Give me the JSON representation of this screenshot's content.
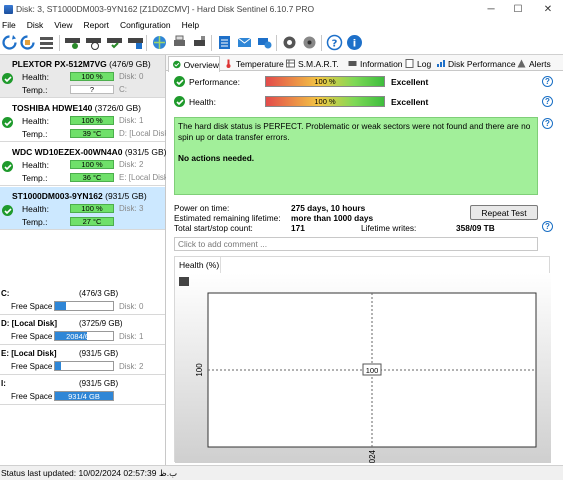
{
  "window": {
    "title": "Disk: 3, ST1000DM003-9YN162 [Z1D0ZCMV]  -  Hard Disk Sentinel 6.10.7 PRO",
    "minimize": "─",
    "maximize": "☐",
    "close": "✕"
  },
  "menu": [
    "File",
    "Disk",
    "View",
    "Report",
    "Configuration",
    "Help"
  ],
  "disks": [
    {
      "name": "PLEXTOR PX-512M7VG",
      "size": "(476/9 GB)",
      "health_label": "Health:",
      "health": "100 %",
      "health_pct": 100,
      "disk_idx": "Disk: 0",
      "temp_label": "Temp.:",
      "temp": "?",
      "temp_extra": "C:"
    },
    {
      "name": "TOSHIBA HDWE140",
      "size": "(3726/0 GB)",
      "health_label": "Health:",
      "health": "100 %",
      "health_pct": 100,
      "disk_idx": "Disk: 1",
      "temp_label": "Temp.:",
      "temp": "39 °C",
      "temp_extra": "D: [Local Disk]"
    },
    {
      "name": "WDC WD10EZEX-00WN4A0",
      "size": "(931/5 GB)",
      "health_label": "Health:",
      "health": "100 %",
      "health_pct": 100,
      "disk_idx": "Disk: 2",
      "temp_label": "Temp.:",
      "temp": "36 °C",
      "temp_extra": "E: [Local Disk]"
    },
    {
      "name": "ST1000DM003-9YN162",
      "size": "(931/5 GB)",
      "health_label": "Health:",
      "health": "100 %",
      "health_pct": 100,
      "disk_idx": "Disk: 3",
      "temp_label": "Temp.:",
      "temp": "27 °C",
      "temp_extra": ""
    }
  ],
  "volumes": [
    {
      "name": "C:",
      "size": "(476/3 GB)",
      "free_label": "Free Space",
      "free": "90/1 GB",
      "free_pct": 19,
      "disk": "Disk: 0"
    },
    {
      "name": "D: [Local Disk]",
      "size": "(3725/9 GB)",
      "free_label": "Free Space",
      "free": "2084/6 GB",
      "free_pct": 56,
      "disk": "Disk: 1"
    },
    {
      "name": "E: [Local Disk]",
      "size": "(931/5 GB)",
      "free_label": "Free Space",
      "free": "99/4 GB",
      "free_pct": 11,
      "disk": "Disk: 2"
    },
    {
      "name": "I:",
      "size": "(931/5 GB)",
      "free_label": "Free Space",
      "free": "931/4 GB",
      "free_pct": 100,
      "disk": ""
    }
  ],
  "tabs": [
    "Overview",
    "Temperature",
    "S.M.A.R.T.",
    "Information",
    "Log",
    "Disk Performance",
    "Alerts"
  ],
  "overview": {
    "performance_label": "Performance:",
    "performance_value": "100 %",
    "performance_pct": 100,
    "performance_rating": "Excellent",
    "health_label": "Health:",
    "health_value": "100 %",
    "health_pct": 100,
    "health_rating": "Excellent",
    "status_text": "The hard disk status is PERFECT. Problematic or weak sectors were not found and there are no spin up or data transfer errors.",
    "status_action": "No actions needed.",
    "power_on_label": "Power on time:",
    "power_on_value": "275 days, 10 hours",
    "lifetime_label": "Estimated remaining lifetime:",
    "lifetime_value": "more than 1000 days",
    "startstop_label": "Total start/stop count:",
    "startstop_value": "171",
    "writes_label": "Lifetime writes:",
    "writes_value": "358/09 TB",
    "repeat_button": "Repeat Test",
    "comment_placeholder": "Click to add comment ..."
  },
  "chart_data": {
    "type": "line",
    "title": "Health (%)",
    "x": [
      "10/02/2024"
    ],
    "series": [
      {
        "values": [
          100
        ]
      }
    ],
    "point_label": "100",
    "y_tick": "100",
    "x_tick": "10/02/2024",
    "grid": "dashed crosshair"
  },
  "statusbar": {
    "text": "Status last updated: 10/02/2024 02:57:39 ب.ظ"
  }
}
